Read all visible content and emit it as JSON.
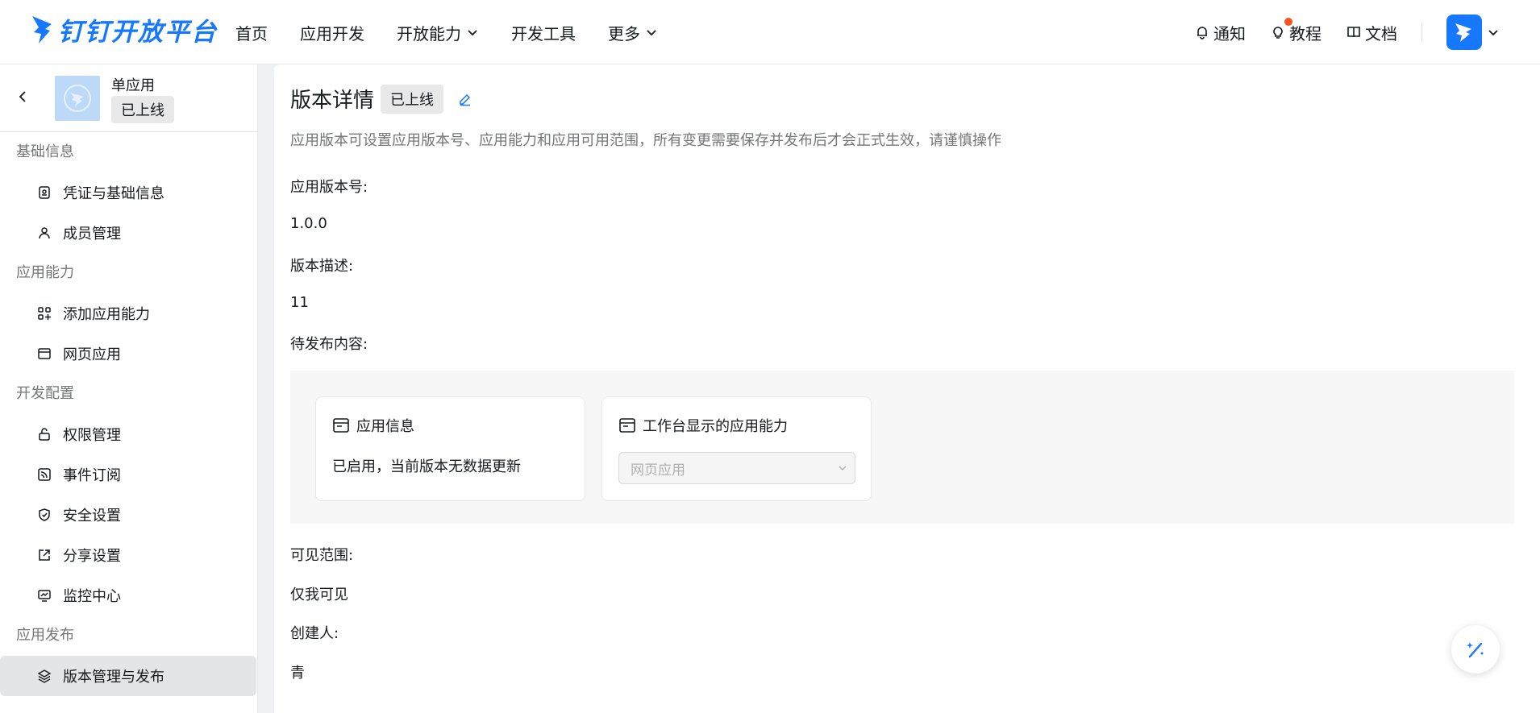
{
  "header": {
    "logo_text": "钉钉开放平台",
    "nav": [
      {
        "label": "首页"
      },
      {
        "label": "应用开发"
      },
      {
        "label": "开放能力"
      },
      {
        "label": "开发工具"
      },
      {
        "label": "更多"
      }
    ],
    "right": {
      "notify": "通知",
      "tutorial": "教程",
      "docs": "文档"
    }
  },
  "sidebar": {
    "app_name": "单应用",
    "app_status": "已上线",
    "groups": [
      {
        "title": "基础信息",
        "items": [
          "凭证与基础信息",
          "成员管理"
        ]
      },
      {
        "title": "应用能力",
        "items": [
          "添加应用能力",
          "网页应用"
        ]
      },
      {
        "title": "开发配置",
        "items": [
          "权限管理",
          "事件订阅",
          "安全设置",
          "分享设置",
          "监控中心"
        ]
      },
      {
        "title": "应用发布",
        "items": [
          "版本管理与发布"
        ]
      }
    ]
  },
  "main": {
    "title": "版本详情",
    "status_badge": "已上线",
    "description": "应用版本可设置应用版本号、应用能力和应用可用范围，所有变更需要保存并发布后才会正式生效，请谨慎操作",
    "version_label": "应用版本号:",
    "version_value": "1.0.0",
    "desc_label": "版本描述:",
    "desc_value": "11",
    "pending_label": "待发布内容:",
    "cards": {
      "app_info_title": "应用信息",
      "app_info_text": "已启用，当前版本无数据更新",
      "workbench_title": "工作台显示的应用能力",
      "workbench_select": "网页应用"
    },
    "scope_label": "可见范围:",
    "scope_value": "仅我可见",
    "creator_label": "创建人:",
    "creator_value": "青"
  },
  "colors": {
    "brand": "#1677ff",
    "active_bg": "#e4e5e7",
    "notify_dot": "#ff5219"
  }
}
